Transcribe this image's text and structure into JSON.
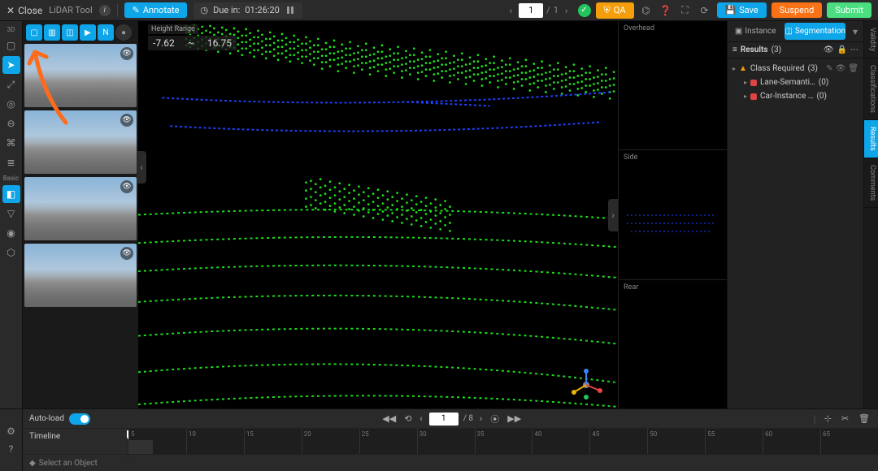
{
  "topbar": {
    "close": "Close",
    "tool": "LiDAR Tool",
    "annotate": "Annotate",
    "due_prefix": "Due in:",
    "due_time": "01:26:20",
    "page_current": "1",
    "page_total": "1",
    "qa": "QA",
    "save": "Save",
    "suspend": "Suspend",
    "submit": "Submit"
  },
  "left_tools": {
    "mode3d": "3D",
    "basic": "Basic"
  },
  "viewer": {
    "hr_label": "Height Range",
    "hr_min": "-7.62",
    "hr_max": "16.75"
  },
  "side_views": {
    "v1": "Overhead",
    "v2": "Side",
    "v3": "Rear"
  },
  "right": {
    "tab_instance": "Instance",
    "tab_segmentation": "Segmentation",
    "results_label": "Results",
    "results_count": "(3)",
    "items": [
      {
        "label": "Class Required",
        "count": "(3)",
        "warn": true
      },
      {
        "label": "Lane-Semanti…",
        "count": "(0)",
        "color": "#d44"
      },
      {
        "label": "Car-Instance …",
        "count": "(0)",
        "color": "#d44"
      }
    ]
  },
  "vtabs": {
    "t1": "Validity",
    "t2": "Classifications",
    "t3": "Results",
    "t4": "Comments"
  },
  "frame": {
    "autoload": "Auto-load",
    "current": "1",
    "total": "/ 8",
    "timeline": "Timeline",
    "select": "Select an Object",
    "ticks": [
      "5",
      "10",
      "15",
      "20",
      "25",
      "30",
      "35",
      "40",
      "45",
      "50",
      "55",
      "60",
      "65"
    ]
  }
}
